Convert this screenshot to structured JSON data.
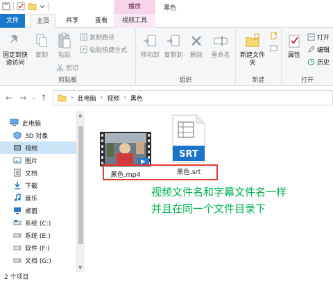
{
  "titlebar": {
    "context_header": "播放",
    "title": "黑色"
  },
  "tabs": {
    "file": "文件",
    "home": "主页",
    "share": "共享",
    "view": "查看",
    "video_tools": "视频工具"
  },
  "ribbon": {
    "clipboard": {
      "pin": "固定到快速访问",
      "copy": "复制",
      "paste": "粘贴",
      "copy_path": "复制路径",
      "paste_shortcut": "粘贴快捷方式",
      "cut": "剪切",
      "label": "剪贴板"
    },
    "organize": {
      "move_to": "移动到",
      "copy_to": "复制到",
      "delete": "删除",
      "rename": "重命名",
      "label": "组织"
    },
    "new": {
      "new_folder": "新建文件夹",
      "label": "新建"
    },
    "open": {
      "properties": "属性",
      "open": "打开",
      "edit": "编辑",
      "history": "历史",
      "label": "打开"
    }
  },
  "address": {
    "crumbs": [
      "此电脑",
      "视频",
      "黑色"
    ]
  },
  "navpane": {
    "items": [
      {
        "label": "此电脑",
        "icon": "computer-icon"
      },
      {
        "label": "3D 对象",
        "icon": "cube-icon"
      },
      {
        "label": "视频",
        "icon": "video-folder-icon"
      },
      {
        "label": "图片",
        "icon": "pictures-icon"
      },
      {
        "label": "文档",
        "icon": "documents-icon"
      },
      {
        "label": "下载",
        "icon": "download-icon"
      },
      {
        "label": "音乐",
        "icon": "music-icon"
      },
      {
        "label": "桌面",
        "icon": "desktop-icon"
      },
      {
        "label": "系统 (C:)",
        "icon": "drive-icon"
      },
      {
        "label": "系统 (E:)",
        "icon": "drive-icon"
      },
      {
        "label": "软件 (F:)",
        "icon": "drive-icon"
      },
      {
        "label": "文档 (G:)",
        "icon": "drive-icon"
      }
    ]
  },
  "files": [
    {
      "name": "黑色.mp4",
      "type": "video"
    },
    {
      "name": "黑色.srt",
      "type": "subtitle",
      "badge": "SRT"
    }
  ],
  "annotation": {
    "line1": "视频文件名和字幕文件名一样",
    "line2": "并且在同一个文件目录下"
  },
  "status": {
    "count": "2 个项目"
  },
  "colors": {
    "file_tab": "#1979ca",
    "context_tab": "#f6d4ea",
    "selection": "#cce4f7",
    "highlight": "#e53935",
    "annotation": "#00b050",
    "srt_badge": "#1a73c8"
  }
}
